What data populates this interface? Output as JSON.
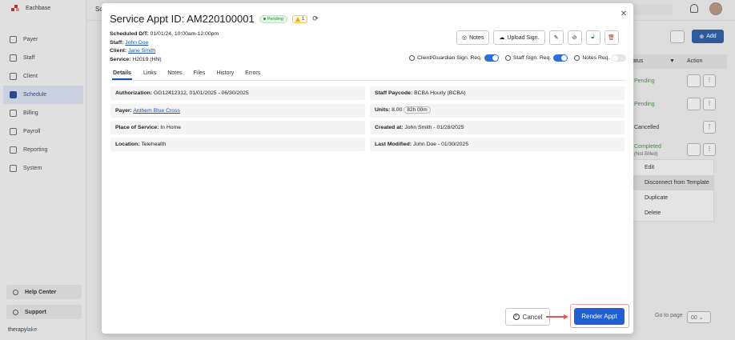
{
  "app": {
    "brand": "Eachbase",
    "footer_logo_a": "therapy",
    "footer_logo_b": "lake",
    "partial_label": "Sc"
  },
  "sidebar": {
    "items": [
      {
        "label": "Payer",
        "icon": "shield-icon"
      },
      {
        "label": "Staff",
        "icon": "people-icon"
      },
      {
        "label": "Client",
        "icon": "person-icon"
      },
      {
        "label": "Schedule",
        "icon": "calendar-icon",
        "active": true
      },
      {
        "label": "Billing",
        "icon": "receipt-icon"
      },
      {
        "label": "Payroll",
        "icon": "payroll-icon"
      },
      {
        "label": "Reporting",
        "icon": "report-icon"
      },
      {
        "label": "System",
        "icon": "gear-icon"
      }
    ],
    "help": "Help Center",
    "support": "Support"
  },
  "background": {
    "add_label": "Add",
    "col_status": "atus",
    "col_action": "Action",
    "rows": [
      {
        "status": "Pending"
      },
      {
        "status": "Pending"
      },
      {
        "status": "Cancelled"
      },
      {
        "status": "Completed",
        "sub": "(Not Billed)"
      }
    ],
    "menu": [
      "Edit",
      "Disconnect from Template",
      "Duplicate",
      "Delete"
    ],
    "pager_label": "Go to page",
    "pager_value": "00"
  },
  "modal": {
    "title": "Service Appt ID: AM220100001",
    "status": "Pending",
    "warning_count": "1",
    "meta": {
      "scheduled_label": "Scheduled D/T:",
      "scheduled_value": "01/01/24, 10:00am-12:00pm",
      "staff_label": "Staff:",
      "staff_value": "John Doe",
      "client_label": "Client:",
      "client_value": "Jane Smith",
      "service_label": "Service:",
      "service_value": "H2019 (HN)"
    },
    "buttons": {
      "notes": "Notes",
      "upload": "Upload Sign."
    },
    "toggles": {
      "client_sign": "Client/Guardian Sign. Req.",
      "staff_sign": "Staff Sign. Req.",
      "notes_req": "Notes Req."
    },
    "tabs": [
      "Details",
      "Links",
      "Notes",
      "Files",
      "History",
      "Errors"
    ],
    "fields": {
      "authorization_label": "Authorization:",
      "authorization_value": "GG12412312, 01/01/2025 - 06/30/2025",
      "payer_label": "Payer:",
      "payer_value": "Anthem Blue Cross",
      "pos_label": "Place of Service:",
      "pos_value": "In Home",
      "location_label": "Location:",
      "location_value": "Telehealth",
      "paycode_label": "Staff Paycode:",
      "paycode_value": "BCBA Hourly (BCBA)",
      "units_label": "Units:",
      "units_value": "8.00",
      "units_pill": "82h 00m",
      "created_label": "Created at:",
      "created_value": "John Smith - 01/28/2025",
      "modified_label": "Last Modified:",
      "modified_value": "John Doe - 01/30/2025"
    },
    "cancel": "Cancel",
    "render": "Render Appt"
  }
}
